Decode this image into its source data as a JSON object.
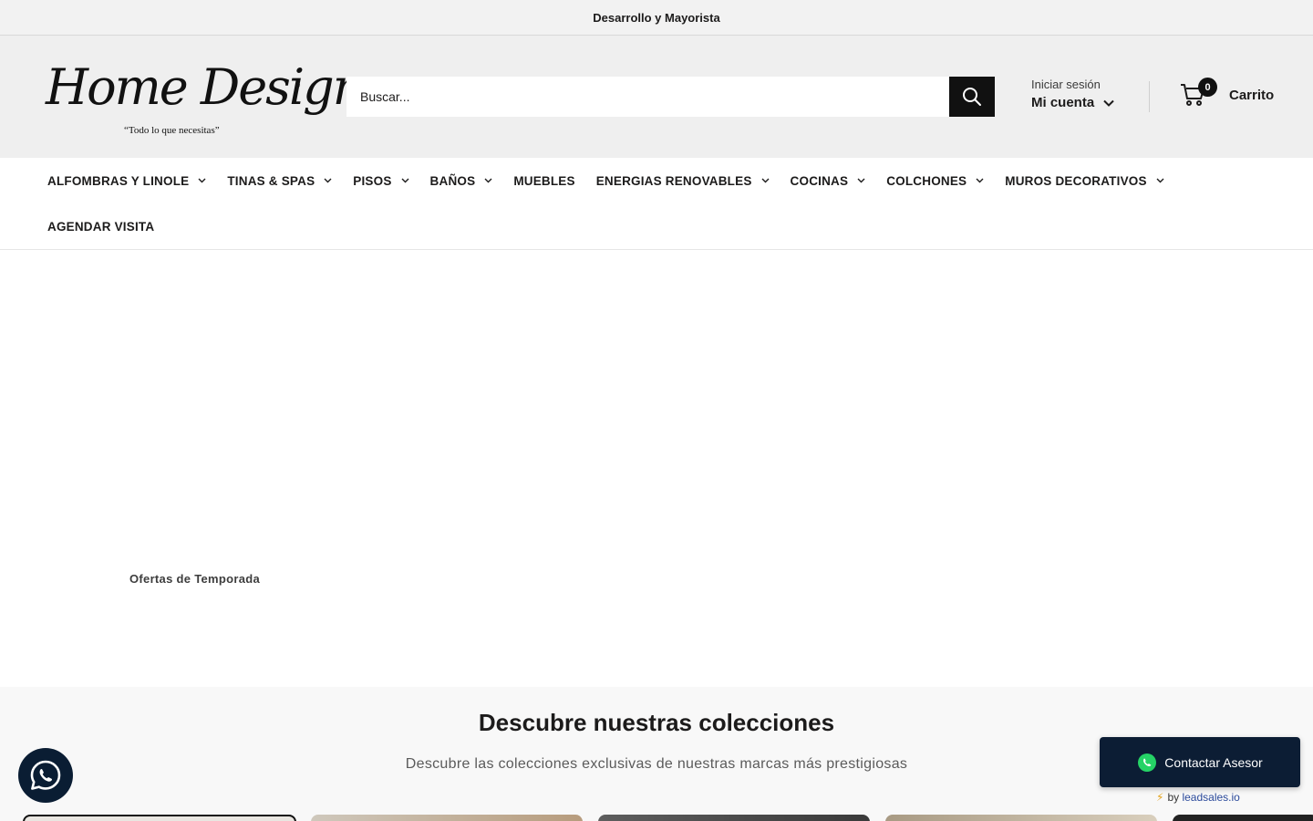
{
  "announcement": {
    "text": "Desarrollo y Mayorista"
  },
  "logo": {
    "script": "Home Design",
    "registered": "®",
    "tagline": "“Todo lo que necesitas”"
  },
  "search": {
    "placeholder": "Buscar..."
  },
  "account": {
    "login_label": "Iniciar sesión",
    "main_label": "Mi cuenta"
  },
  "cart": {
    "count": "0",
    "label": "Carrito"
  },
  "nav": {
    "items": [
      {
        "label": "ALFOMBRAS Y LINOLE",
        "has_dropdown": true
      },
      {
        "label": "TINAS & SPAS",
        "has_dropdown": true
      },
      {
        "label": "PISOS",
        "has_dropdown": true
      },
      {
        "label": "BAÑOS",
        "has_dropdown": true
      },
      {
        "label": "MUEBLES",
        "has_dropdown": false
      },
      {
        "label": "ENERGIAS RENOVABLES",
        "has_dropdown": true
      },
      {
        "label": "COCINAS",
        "has_dropdown": true
      },
      {
        "label": "COLCHONES",
        "has_dropdown": true
      },
      {
        "label": "MUROS DECORATIVOS",
        "has_dropdown": true
      }
    ],
    "second_row": [
      {
        "label": "AGENDAR VISITA",
        "has_dropdown": false
      }
    ]
  },
  "hero": {
    "label": "Ofertas de Temporada"
  },
  "collections": {
    "title": "Descubre nuestras colecciones",
    "subtitle": "Descubre las colecciones exclusivas de nuestras marcas más prestigiosas"
  },
  "contact_widget": {
    "label": "Contactar Asesor",
    "by": "by",
    "brand": "leadsales.io"
  },
  "colors": {
    "dark": "#111111",
    "widget": "#0c1d34",
    "whatsapp": "#25d366",
    "header_bg": "#efefef"
  },
  "icons": {
    "search": "search-icon",
    "cart": "cart-icon",
    "chevron": "chevron-down-icon",
    "whatsapp": "whatsapp-icon"
  }
}
